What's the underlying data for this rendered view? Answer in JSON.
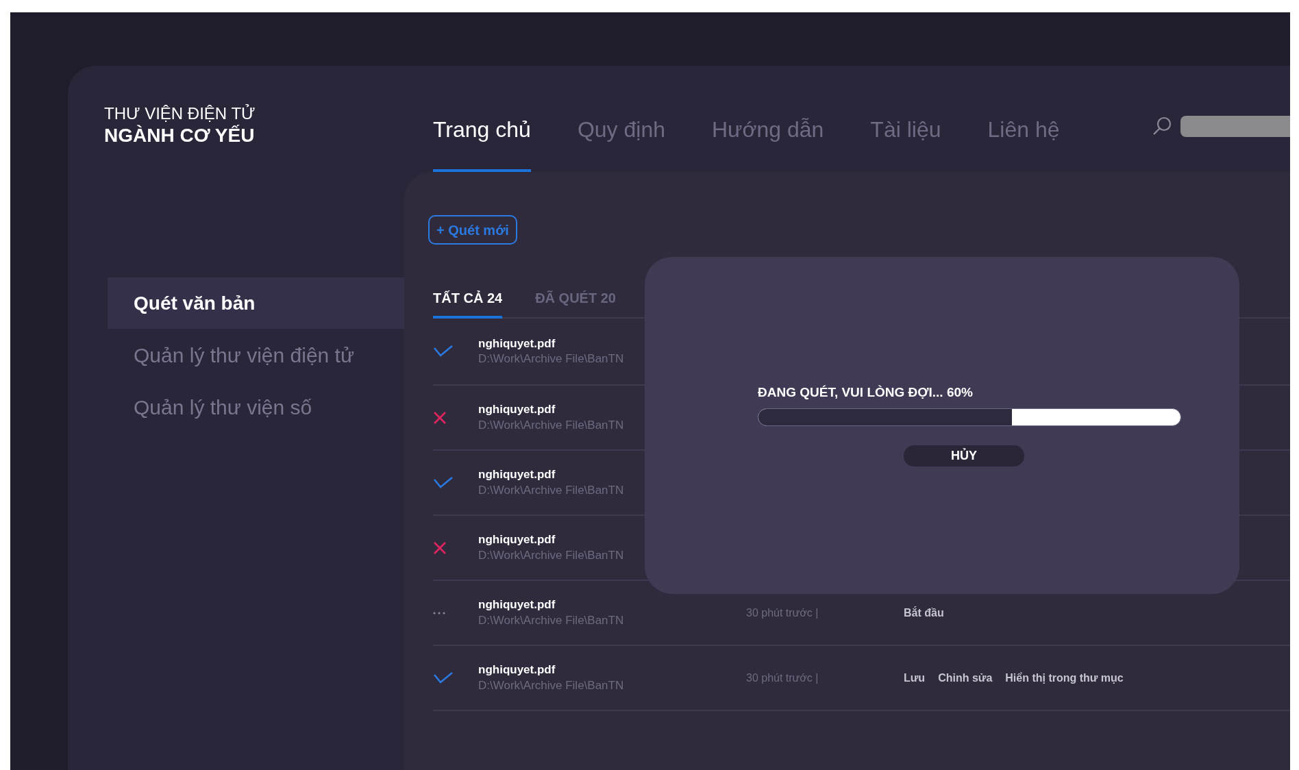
{
  "brand": {
    "line_1": "THƯ VIỆN ĐIỆN TỬ",
    "line_2": "NGÀNH CƠ YẾU"
  },
  "nav": [
    {
      "label": "Trang chủ",
      "selected": true
    },
    {
      "label": "Quy định",
      "selected": false
    },
    {
      "label": "Hướng dẫn",
      "selected": false
    },
    {
      "label": "Tài liệu",
      "selected": false
    },
    {
      "label": "Liên hệ",
      "selected": false
    }
  ],
  "sidebar": {
    "items": [
      {
        "label": "Quét văn bản",
        "selected": true
      },
      {
        "label": "Quản lý thư viện điện tử",
        "selected": false
      },
      {
        "label": "Quản lý thư viện số",
        "selected": false
      }
    ]
  },
  "new_scan_button": "+ Quét mới",
  "tabs": [
    {
      "label": "TẤT CẢ 24",
      "selected": true
    },
    {
      "label": "ĐÃ QUÉT 20",
      "selected": false
    }
  ],
  "files": [
    {
      "kind": "done",
      "name": "nghiquyet.pdf",
      "path": "D:\\Work\\Archive File\\BanTN"
    },
    {
      "kind": "failed",
      "name": "nghiquyet.pdf",
      "path": "D:\\Work\\Archive File\\BanTN"
    },
    {
      "kind": "done",
      "name": "nghiquyet.pdf",
      "path": "D:\\Work\\Archive File\\BanTN"
    },
    {
      "kind": "failed",
      "name": "nghiquyet.pdf",
      "path": "D:\\Work\\Archive File\\BanTN"
    },
    {
      "kind": "pending",
      "name": "nghiquyet.pdf",
      "path": "D:\\Work\\Archive File\\BanTN",
      "time": "30 phút trước |",
      "actions": [
        "Bắt đầu"
      ]
    },
    {
      "kind": "done",
      "name": "nghiquyet.pdf",
      "path": "D:\\Work\\Archive File\\BanTN",
      "time": "30 phút trước |",
      "actions": [
        "Lưu",
        "Chỉnh sửa",
        "Hiển thị trong thư mục"
      ]
    }
  ],
  "dialog": {
    "message": "ĐANG QUÉT, VUI LÒNG ĐỢI... 60%",
    "level": 0.6,
    "cancel_button": "HỦY"
  }
}
